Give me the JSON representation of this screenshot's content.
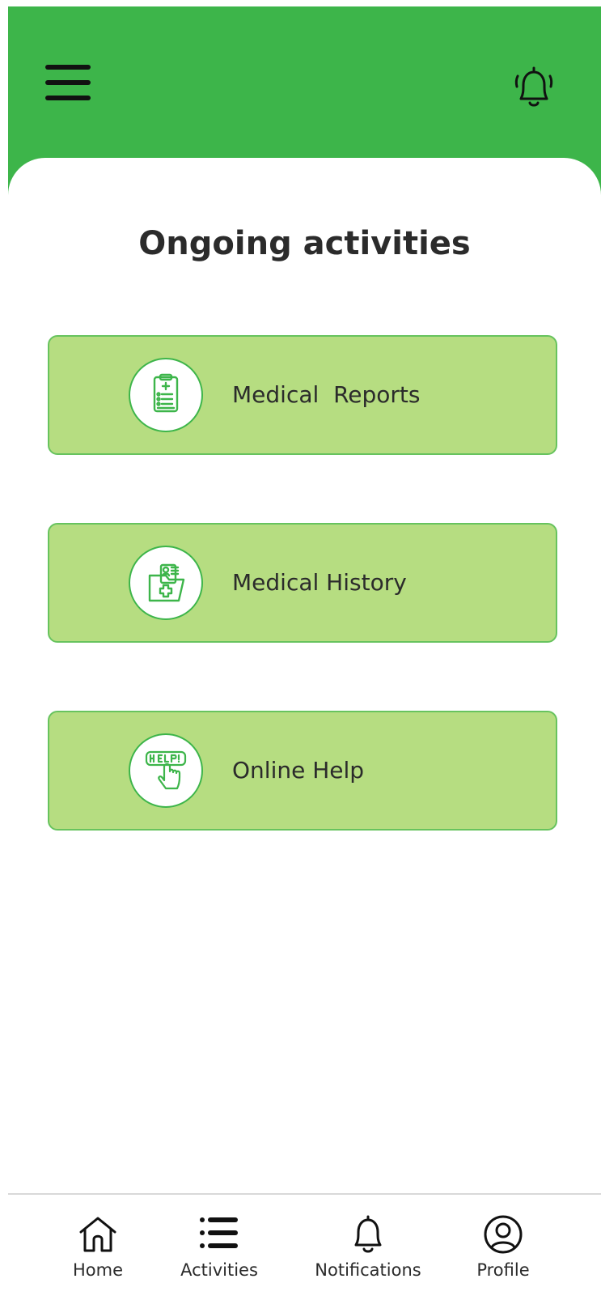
{
  "header": {
    "menu_icon": "hamburger-menu-icon",
    "notification_icon": "ringing-bell-icon",
    "color": "#3db54a"
  },
  "main": {
    "title": "Ongoing activities",
    "cards": [
      {
        "label": "Medical  Reports",
        "icon": "clipboard-medical-report-icon"
      },
      {
        "label": "Medical History",
        "icon": "medical-folder-icon"
      },
      {
        "label": "Online Help",
        "icon": "help-sign-hand-icon"
      }
    ],
    "card_color": "#b6dd81",
    "card_border_color": "#67c35e"
  },
  "bottom_nav": {
    "items": [
      {
        "label": "Home",
        "icon": "home-icon"
      },
      {
        "label": "Activities",
        "icon": "list-icon"
      },
      {
        "label": "Notifications",
        "icon": "bell-icon"
      },
      {
        "label": "Profile",
        "icon": "user-circle-icon"
      }
    ]
  }
}
